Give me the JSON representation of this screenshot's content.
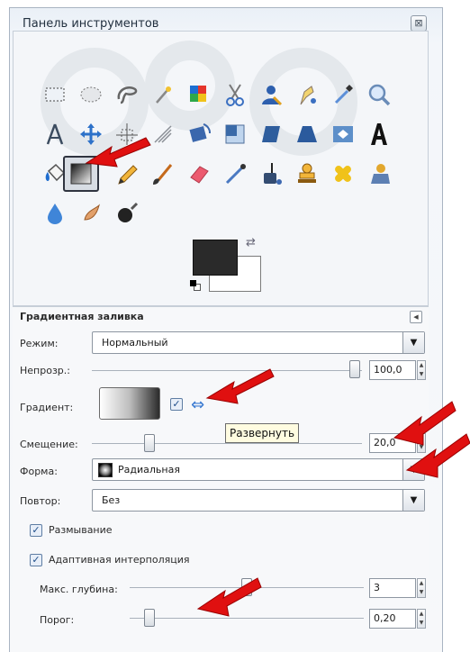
{
  "window": {
    "title": "Панель инструментов",
    "close_glyph": "⊠"
  },
  "colors": {
    "foreground": "#2a2a2a",
    "background": "#ffffff",
    "arrow": "#e01010"
  },
  "tools": [
    {
      "name": "rect-select-icon"
    },
    {
      "name": "ellipse-select-icon"
    },
    {
      "name": "free-select-icon"
    },
    {
      "name": "fuzzy-select-icon"
    },
    {
      "name": "color-select-icon"
    },
    {
      "name": "scissors-select-icon"
    },
    {
      "name": "foreground-select-icon"
    },
    {
      "name": "paths-icon"
    },
    {
      "name": "color-picker-icon"
    },
    {
      "name": "zoom-icon"
    },
    {
      "name": "measure-icon"
    },
    {
      "name": "move-icon"
    },
    {
      "name": "align-icon"
    },
    {
      "name": "crop-icon"
    },
    {
      "name": "rotate-icon"
    },
    {
      "name": "scale-icon"
    },
    {
      "name": "shear-icon"
    },
    {
      "name": "perspective-icon"
    },
    {
      "name": "flip-icon"
    },
    {
      "name": "text-icon"
    },
    {
      "name": "bucket-fill-icon"
    },
    {
      "name": "blend-icon"
    },
    {
      "name": "pencil-icon"
    },
    {
      "name": "paintbrush-icon"
    },
    {
      "name": "eraser-icon"
    },
    {
      "name": "airbrush-icon"
    },
    {
      "name": "ink-icon"
    },
    {
      "name": "clone-icon"
    },
    {
      "name": "heal-icon"
    },
    {
      "name": "perspective-clone-icon"
    },
    {
      "name": "blur-sharpen-icon"
    },
    {
      "name": "smudge-icon"
    },
    {
      "name": "dodge-burn-icon"
    }
  ],
  "options": {
    "panel_title": "Градиентная заливка",
    "mode_label": "Режим:",
    "mode_value": "Нормальный",
    "opacity_label": "Непрозр.:",
    "opacity_value": "100,0",
    "opacity_level": 1.0,
    "gradient_label": "Градиент:",
    "gradient_reverse_checked": true,
    "tooltip": "Развернуть",
    "offset_label": "Смещение:",
    "offset_value": "20,0",
    "shape_label": "Форма:",
    "shape_value": "Радиальная",
    "repeat_label": "Повтор:",
    "repeat_value": "Без",
    "dither_label": "Размывание",
    "dither_checked": true,
    "adaptive_label": "Адаптивная интерполяция",
    "adaptive_checked": true,
    "max_depth_label": "Макс. глубина:",
    "max_depth_value": "3",
    "threshold_label": "Порог:",
    "threshold_value": "0,20"
  }
}
